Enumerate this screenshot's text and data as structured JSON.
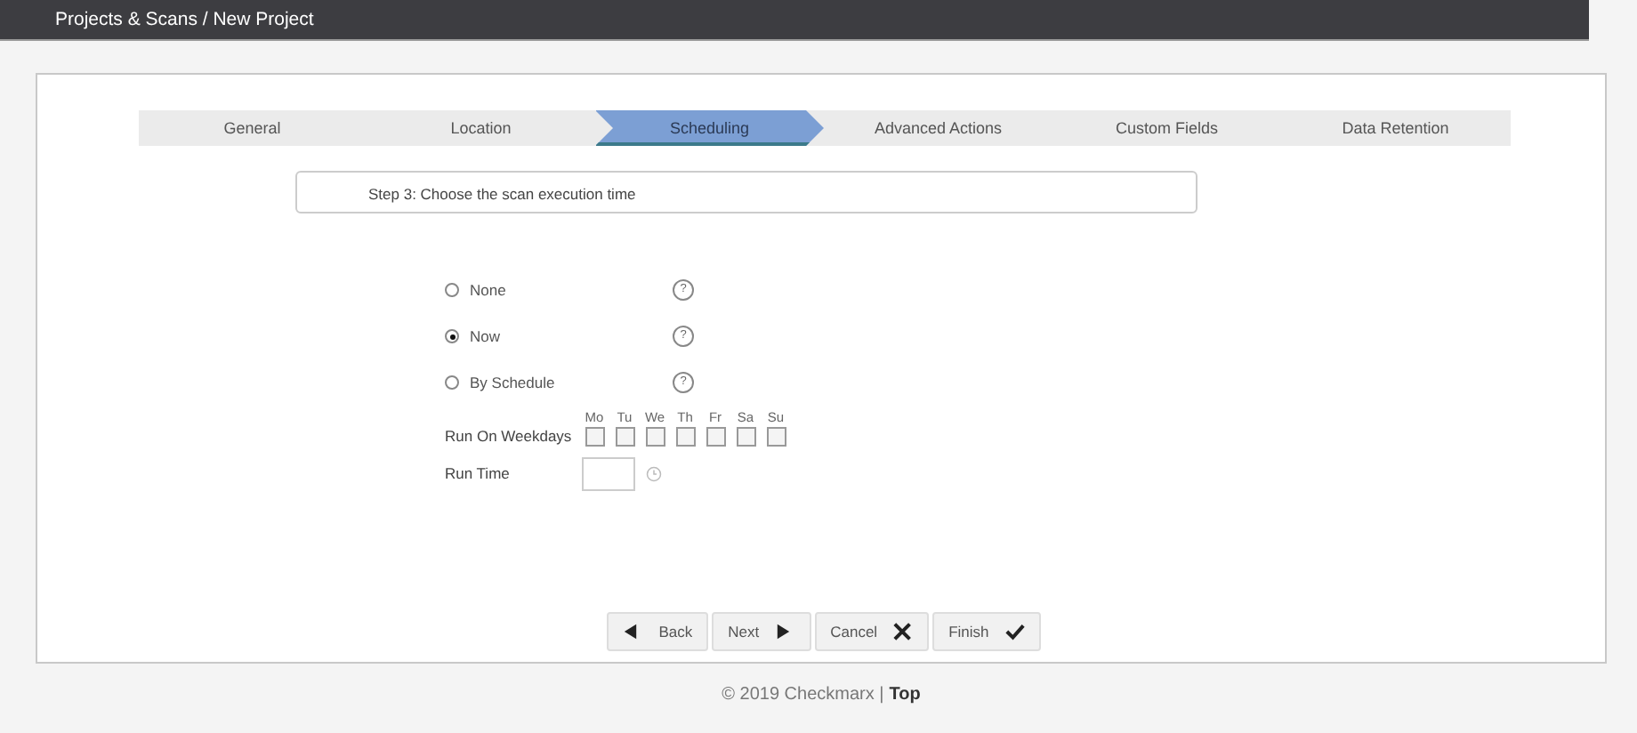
{
  "header": {
    "breadcrumb": "Projects & Scans / New Project"
  },
  "steps": [
    {
      "label": "General",
      "selected": false
    },
    {
      "label": "Location",
      "selected": false
    },
    {
      "label": "Scheduling",
      "selected": true
    },
    {
      "label": "Advanced Actions",
      "selected": false
    },
    {
      "label": "Custom Fields",
      "selected": false
    },
    {
      "label": "Data Retention",
      "selected": false
    }
  ],
  "instruction": "Step 3: Choose the scan execution time",
  "options": [
    {
      "label": "None",
      "selected": false,
      "help": "?"
    },
    {
      "label": "Now",
      "selected": true,
      "help": "?"
    },
    {
      "label": "By Schedule",
      "selected": false,
      "help": "?"
    }
  ],
  "weekdays": {
    "label": "Run On Weekdays",
    "days": [
      {
        "label": "Mo",
        "checked": false
      },
      {
        "label": "Tu",
        "checked": false
      },
      {
        "label": "We",
        "checked": false
      },
      {
        "label": "Th",
        "checked": false
      },
      {
        "label": "Fr",
        "checked": false
      },
      {
        "label": "Sa",
        "checked": false
      },
      {
        "label": "Su",
        "checked": false
      }
    ]
  },
  "run_time": {
    "label": "Run Time"
  },
  "buttons": [
    {
      "label": "Back",
      "kind": "back"
    },
    {
      "label": "Next",
      "kind": "next"
    },
    {
      "label": "Cancel",
      "kind": "cancel"
    },
    {
      "label": "Finish",
      "kind": "finish"
    }
  ],
  "footer": {
    "text": "© 2019 Checkmarx |",
    "link": "Top"
  }
}
